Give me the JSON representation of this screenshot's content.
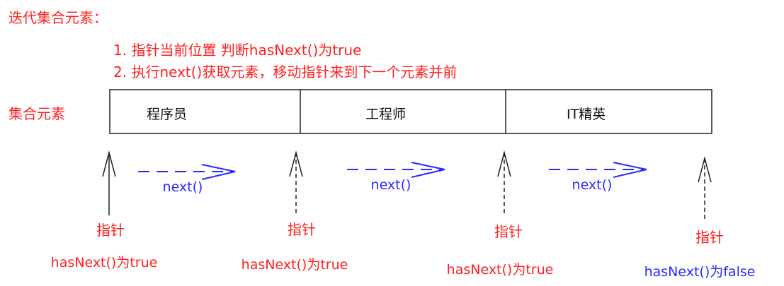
{
  "title": "迭代集合元素：",
  "steps": [
    "1. 指针当前位置 判断hasNext()为true",
    "2. 执行next()获取元素，移动指针来到下一个元素并前"
  ],
  "collection_label": "集合元素",
  "elements": [
    "程序员",
    "工程师",
    "IT精英"
  ],
  "pointer_label": "指针",
  "next_label": "next()",
  "has_next": [
    "hasNext()为true",
    "hasNext()为true",
    "hasNext()为true",
    "hasNext()为false"
  ],
  "colors": {
    "red": "#ff2020",
    "blue": "#2a2aff",
    "black": "#111111"
  }
}
